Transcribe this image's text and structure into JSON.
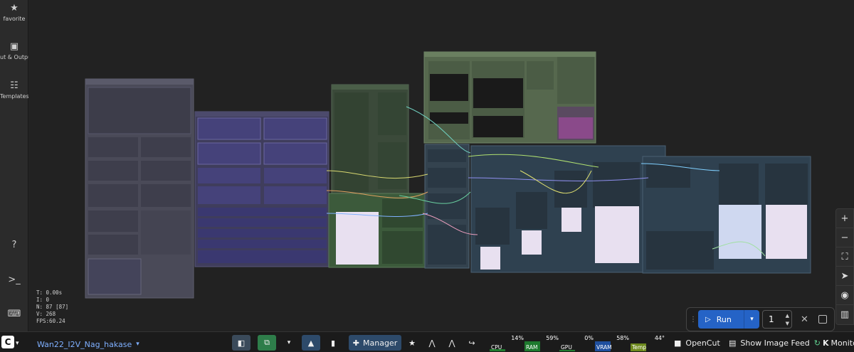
{
  "sidebar": {
    "items": [
      {
        "label": "favorite",
        "icon": "star-icon"
      },
      {
        "label": "ut & Output",
        "icon": "image-icon"
      },
      {
        "label": "Templates",
        "icon": "templates-icon"
      }
    ]
  },
  "stats": {
    "t": "T: 0.00s",
    "i": "I: 0",
    "n": "N: 87 [87]",
    "v": "V: 268",
    "fps": "FPS:60.24"
  },
  "run": {
    "label": "Run",
    "count": "1"
  },
  "toolbar": {
    "workflow_name": "Wan22_I2V_Nag_hakase",
    "manager_label": "Manager",
    "opencut_label": "OpenCut",
    "image_feed_label": "Show Image Feed",
    "monitor_label": "Monitor"
  },
  "meters": [
    {
      "name": "CPU",
      "value": "14%",
      "fill": 0.14,
      "color": "#1e7a2e"
    },
    {
      "name": "RAM",
      "value": "59%",
      "fill": 0.59,
      "color": "#1e7a2e"
    },
    {
      "name": "GPU",
      "value": "0%",
      "fill": 0.0,
      "color": "#1e7a2e"
    },
    {
      "name": "VRAM",
      "value": "58%",
      "fill": 0.58,
      "color": "#1f4f9e"
    },
    {
      "name": "Temp",
      "value": "44°",
      "fill": 0.44,
      "color": "#6e8a1e"
    }
  ],
  "colors": {
    "accent": "#2563c6",
    "canvas_bg": "#222222"
  }
}
